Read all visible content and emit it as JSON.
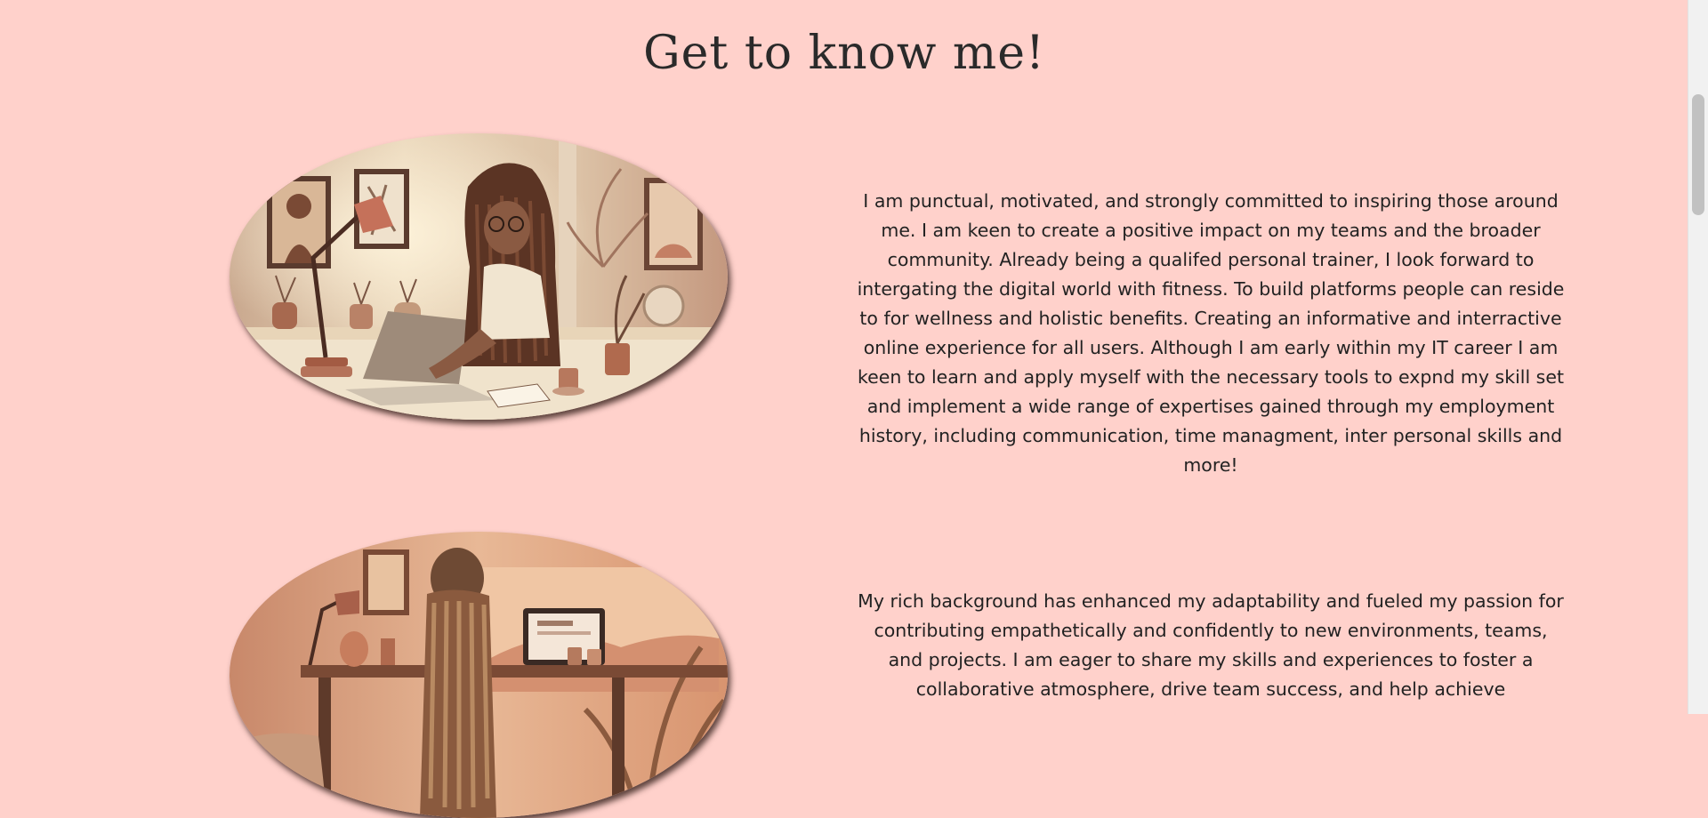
{
  "about": {
    "title": "Get to know me!",
    "sections": [
      {
        "image_icon": "woman-working-at-laptop-illustration",
        "text": "I am punctual, motivated, and strongly committed to inspiring those around me. I am keen to create a positive impact on my teams and the broader community. Already being a qualifed personal trainer, I look forward to intergating the digital world with fitness. To build platforms people can reside to for wellness and holistic benefits. Creating an informative and interractive online experience for all users. Although I am early within my IT career I am keen to learn and apply myself with the necessary tools to expnd my skill set and implement a wide range of expertises gained through my employment history, including communication, time managment, inter personal skills and more!"
      },
      {
        "image_icon": "woman-at-desk-from-behind-illustration",
        "text": "My rich background has enhanced my adaptability and fueled my passion for contributing empathetically and confidently to new environments, teams, and projects. I am eager to share my skills and experiences to foster a collaborative atmosphere, drive team success, and help achieve"
      }
    ]
  },
  "colors": {
    "background": "#ffd1cb",
    "text": "#222222"
  }
}
